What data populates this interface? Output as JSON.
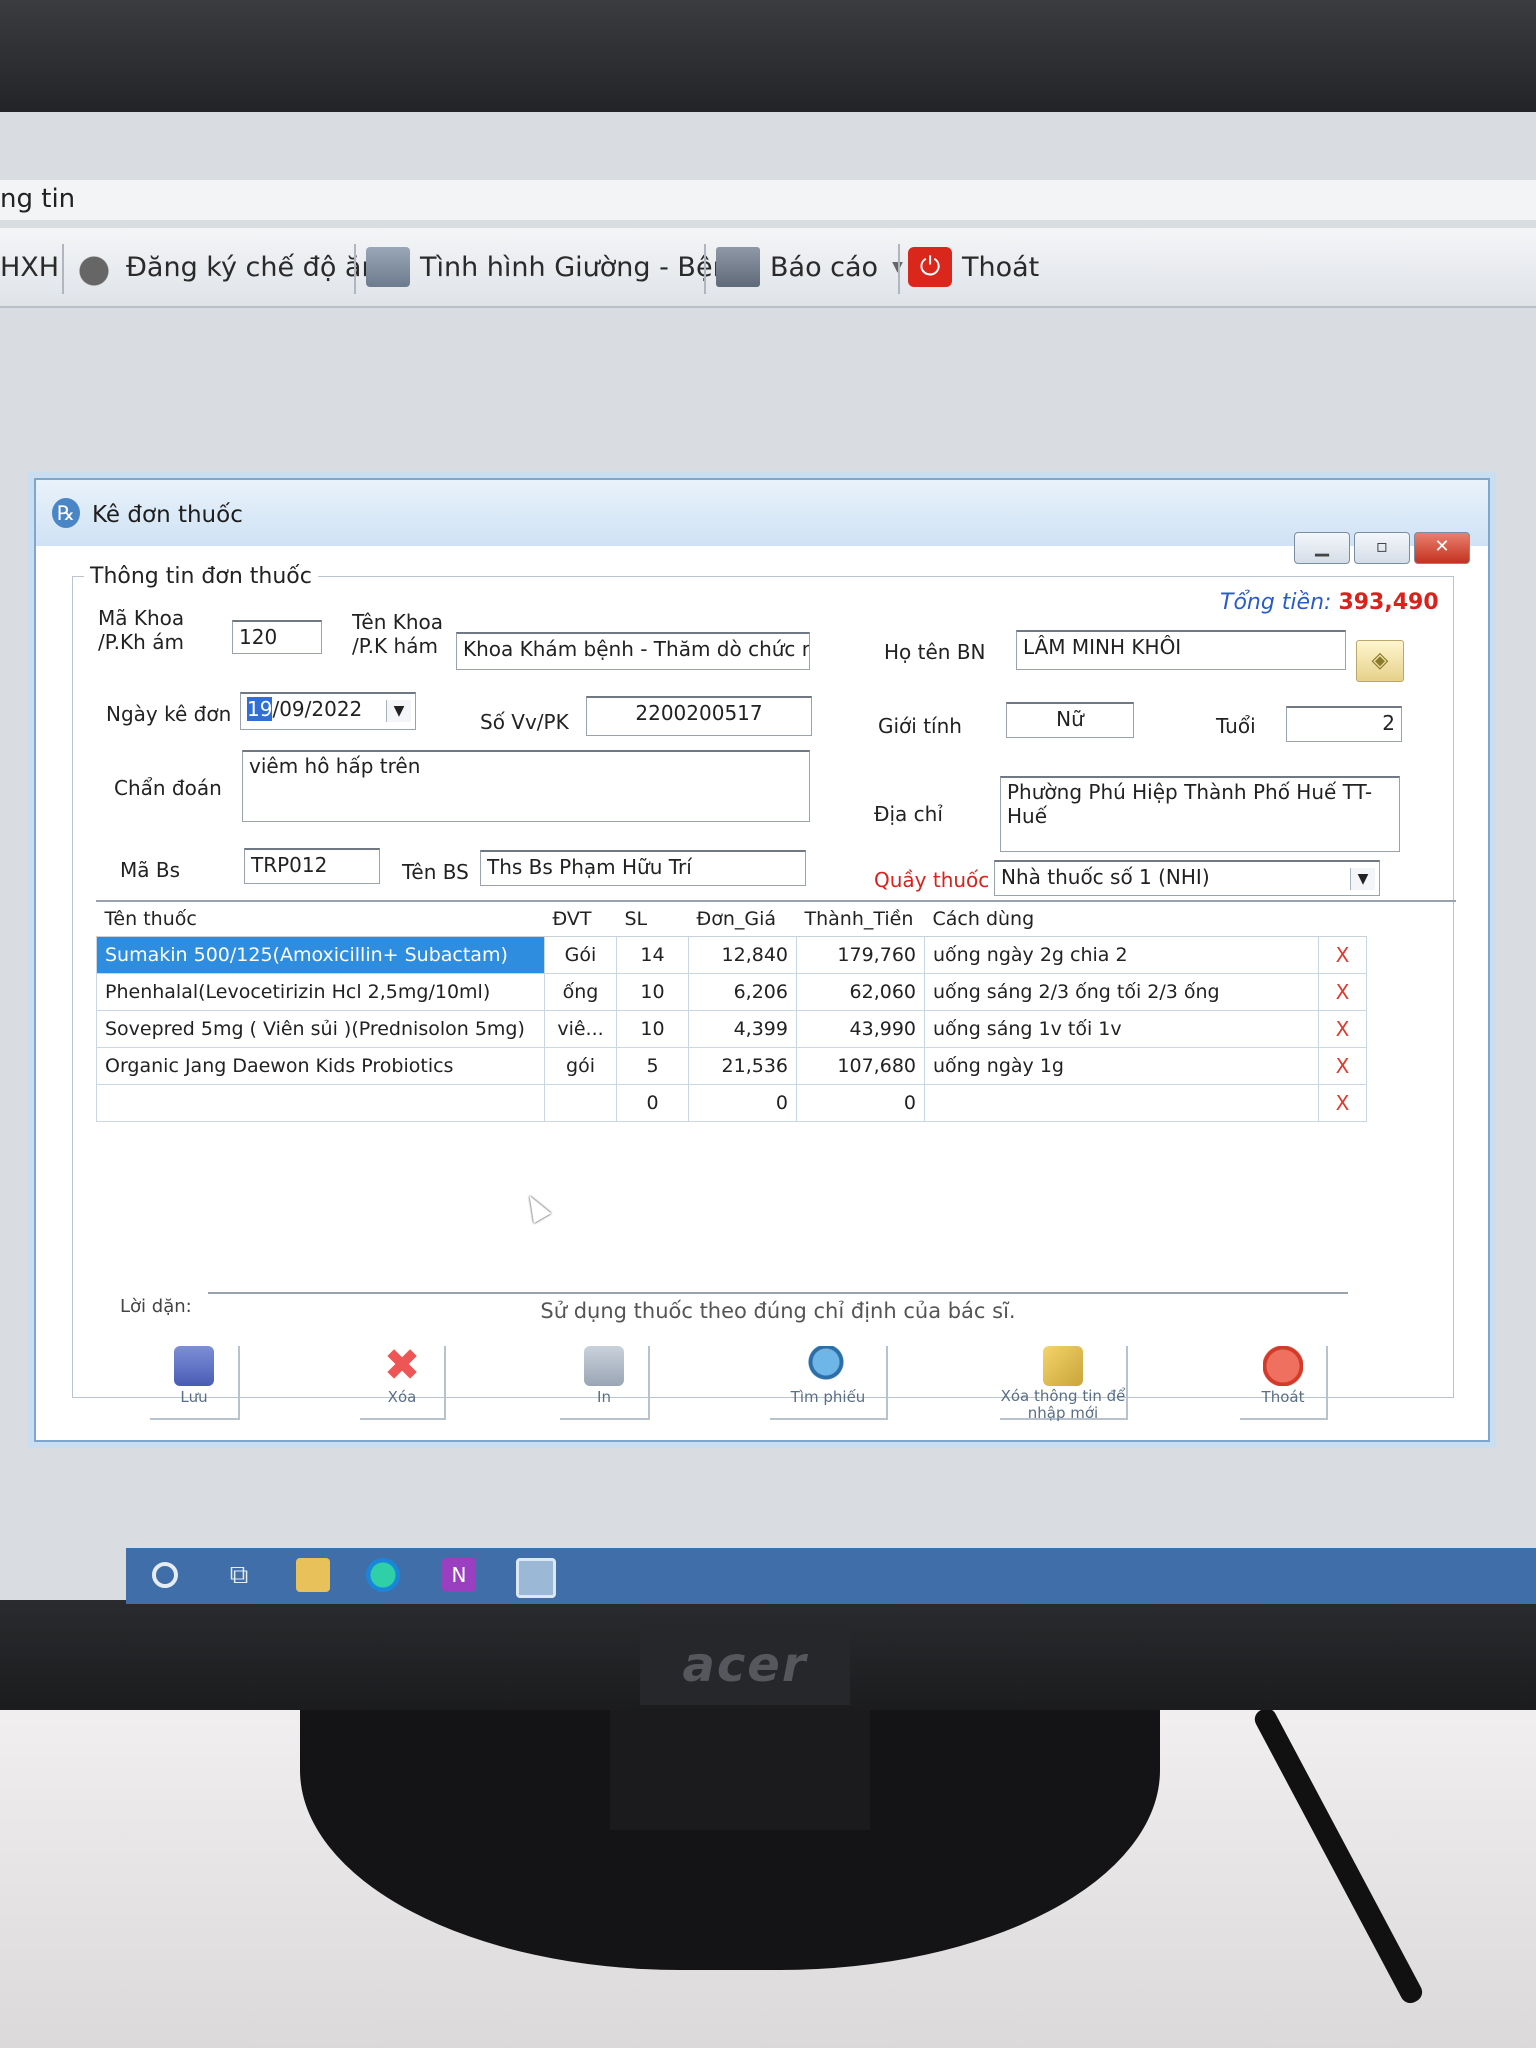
{
  "menu": {
    "partial_label": "ng tin"
  },
  "toolbar": {
    "items": [
      {
        "label": "HXH",
        "icon": "none"
      },
      {
        "label": "Đăng ký chế độ ăn",
        "icon": "food-icon"
      },
      {
        "label": "Tình hình Giường - Bệnh",
        "icon": "bed-icon"
      },
      {
        "label": "Báo cáo",
        "icon": "report-icon"
      },
      {
        "label": "Thoát",
        "icon": "power-icon"
      }
    ]
  },
  "dialog": {
    "title": "Kê đơn thuốc",
    "group_title": "Thông tin đơn thuốc",
    "total_label": "Tổng tiền:",
    "total_value": "393,490",
    "labels": {
      "ma_khoa": "Mã Khoa /P.Kh ám",
      "ten_khoa": "Tên Khoa /P.K hám",
      "ho_ten_bn": "Họ tên BN",
      "ngay_ke_don": "Ngày kê đơn",
      "so_vv": "Số Vv/PK",
      "gioi_tinh": "Giới tính",
      "tuoi": "Tuổi",
      "chan_doan": "Chẩn đoán",
      "dia_chi": "Địa chỉ",
      "ma_bs": "Mã Bs",
      "ten_bs": "Tên BS",
      "quay_thuoc": "Quầy thuốc"
    },
    "values": {
      "ma_khoa": "120",
      "ten_khoa": "Khoa Khám bệnh - Thăm dò chức n",
      "ho_ten_bn": "LÂM MINH KHÔI",
      "ngay_ke_don_sel": "19",
      "ngay_ke_don_rest": "/09/2022",
      "so_vv": "2200200517",
      "gioi_tinh": "Nữ",
      "tuoi": "2",
      "chan_doan": "viêm hô hấp trên",
      "dia_chi": "Phường Phú Hiệp Thành Phố Huế TT-Huế",
      "ma_bs": "TRP012",
      "ten_bs": "Ths Bs Phạm Hữu Trí",
      "quay_thuoc": "Nhà thuốc số 1 (NHI)"
    },
    "grid": {
      "columns": [
        "Tên thuốc",
        "ĐVT",
        "SL",
        "Đơn_Giá",
        "Thành_Tiền",
        "Cách dùng"
      ],
      "rows": [
        {
          "name": "Sumakin 500/125(Amoxicillin+ Subactam)",
          "dvt": "Gói",
          "sl": "14",
          "gia": "12,840",
          "tien": "179,760",
          "cach": "uống ngày 2g chia 2",
          "del": "X"
        },
        {
          "name": "Phenhalal(Levocetirizin Hcl 2,5mg/10ml)",
          "dvt": "ống",
          "sl": "10",
          "gia": "6,206",
          "tien": "62,060",
          "cach": "uống sáng 2/3 ống tối 2/3 ống",
          "del": "X"
        },
        {
          "name": "Sovepred 5mg ( Viên sủi )(Prednisolon 5mg)",
          "dvt": "viê...",
          "sl": "10",
          "gia": "4,399",
          "tien": "43,990",
          "cach": "uống sáng 1v tối 1v",
          "del": "X"
        },
        {
          "name": "Organic Jang Daewon Kids Probiotics",
          "dvt": "gói",
          "sl": "5",
          "gia": "21,536",
          "tien": "107,680",
          "cach": "uống ngày 1g",
          "del": "X"
        },
        {
          "name": "",
          "dvt": "",
          "sl": "0",
          "gia": "0",
          "tien": "0",
          "cach": "",
          "del": "X"
        }
      ]
    },
    "note_label": "Lời dặn:",
    "note_value": "Sử dụng thuốc theo đúng chỉ định của bác sĩ.",
    "buttons": {
      "save": "Lưu",
      "delete": "Xóa",
      "print": "In",
      "find": "Tìm phiếu",
      "clear": "Xóa thông tin để nhập mới",
      "exit": "Thoát"
    }
  },
  "monitor": {
    "brand": "acer"
  }
}
